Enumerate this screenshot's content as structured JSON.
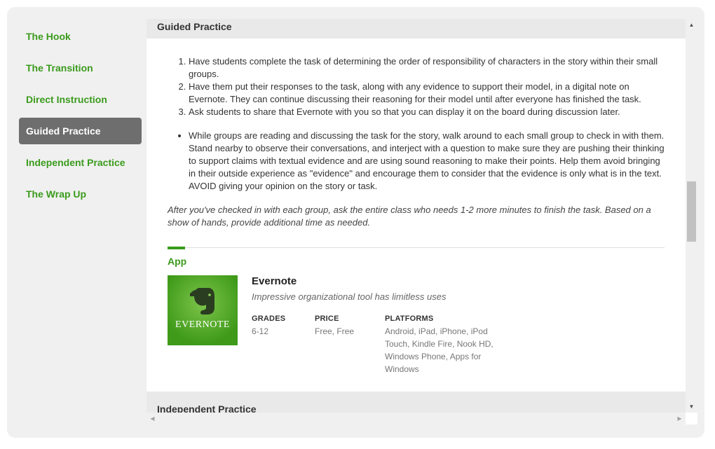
{
  "sidebar": {
    "items": [
      {
        "label": "The Hook"
      },
      {
        "label": "The Transition"
      },
      {
        "label": "Direct Instruction"
      },
      {
        "label": "Guided Practice",
        "active": true
      },
      {
        "label": "Independent Practice"
      },
      {
        "label": "The Wrap Up"
      }
    ]
  },
  "main": {
    "section_title": "Guided Practice",
    "steps": [
      "Have students complete the task of determining the order of responsibility of characters in the story within their small groups.",
      "Have them put their responses to the task, along with any evidence to support their model, in a digital note on Evernote. They can continue discussing their reasoning for their model until after everyone has finished the task.",
      "Ask students to share that Evernote with you so that you can display it on the board during discussion later."
    ],
    "bullets": [
      "While groups are reading and discussing the task for the story, walk around to each small group to check in with them. Stand nearby to observe their conversations, and interject with a question to make sure they are pushing their thinking to support claims with textual evidence and are using sound reasoning to make their points. Help them avoid bringing in their outside experience as \"evidence\" and encourage them to consider that the evidence is only what is in the text. AVOID giving your opinion on the story or task."
    ],
    "note": "After you've checked in with each group, ask the entire class who needs 1-2 more minutes to finish the task. Based on a show of hands, provide additional time as needed.",
    "app_section_label": "App",
    "app": {
      "logo_text": "EVERNOTE",
      "name": "Evernote",
      "description": "Impressive organizational tool has limitless uses",
      "grades_label": "GRADES",
      "grades": "6-12",
      "price_label": "PRICE",
      "price": "Free, Free",
      "platforms_label": "PLATFORMS",
      "platforms": "Android, iPad, iPhone, iPod Touch, Kindle Fire, Nook HD, Windows Phone, Apps for Windows"
    },
    "next_section_title": "Independent Practice"
  },
  "icons": {
    "scroll_up": "arrow-up-icon",
    "scroll_down": "arrow-down-icon",
    "scroll_left": "arrow-left-icon",
    "scroll_right": "arrow-right-icon",
    "app_logo": "evernote-elephant-icon"
  },
  "colors": {
    "accent": "#3a9b1c",
    "active_nav_bg": "#6e6e6e"
  }
}
